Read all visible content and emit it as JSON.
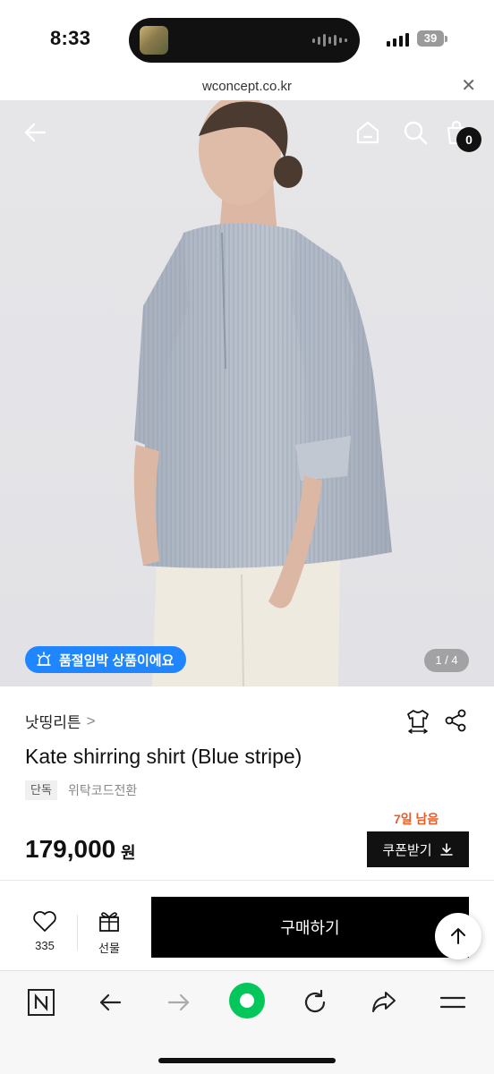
{
  "status_bar": {
    "time": "8:33",
    "battery": "39"
  },
  "url_bar": {
    "domain": "wconcept.co.kr",
    "close_icon": "close-icon"
  },
  "hero": {
    "cart_count": "0",
    "stock_badge": "품절임박 상품이에요",
    "page_indicator": "1 / 4",
    "icons": [
      "back-arrow-icon",
      "home-icon",
      "search-icon",
      "cart-icon"
    ]
  },
  "product": {
    "brand": "낫띵리튼",
    "brand_chevron": ">",
    "title": "Kate shirring shirt (Blue stripe)",
    "tag_exclusive": "단독",
    "tag_code": "위탁코드전환",
    "days_left": "7일 남음",
    "price": "179,000",
    "currency": "원",
    "coupon_button": "쿠폰받기"
  },
  "purchase_bar": {
    "like_count": "335",
    "gift_label": "선물",
    "buy_button": "구매하기"
  },
  "colors": {
    "badge_blue": "#1f86ff",
    "accent_orange": "#ea5c27",
    "active_green": "#03c75a"
  }
}
